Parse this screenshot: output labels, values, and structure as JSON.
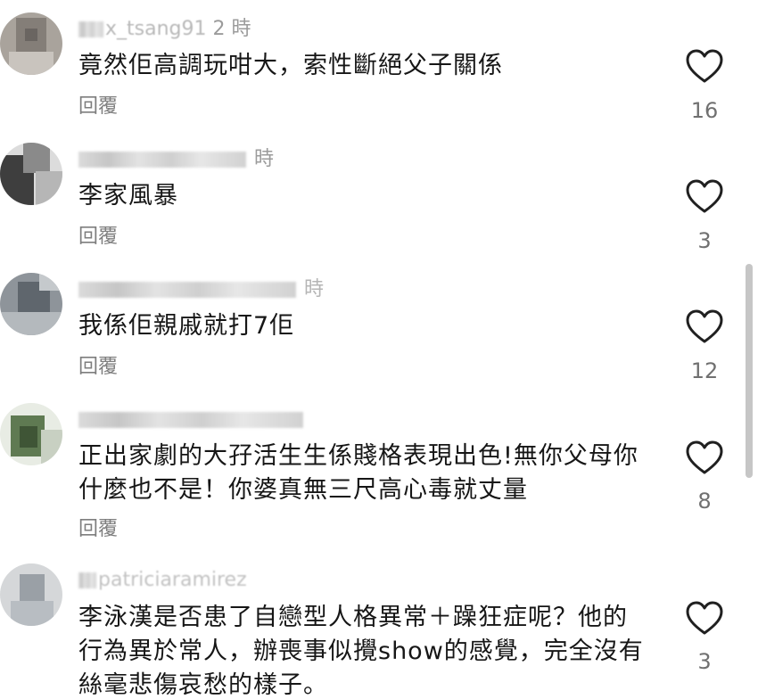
{
  "comments": [
    {
      "username_visible": "x_tsang91",
      "time_suffix": "2 時",
      "text": "竟然佢高調玩咁大，索性斷絕父子關係",
      "reply_label": "回覆",
      "likes": "16"
    },
    {
      "username_visible": "",
      "time_suffix": "時",
      "text": "李家風暴",
      "reply_label": "回覆",
      "likes": "3"
    },
    {
      "username_visible": "",
      "time_suffix": "時",
      "text": "我係佢親戚就打7佢",
      "reply_label": "回覆",
      "likes": "12"
    },
    {
      "username_visible": "",
      "time_suffix": "",
      "text": "正出家劇的大孖活生生係賤格表現出色!無你父母你什麼也不是！你婆真無三尺高心毒就丈量",
      "reply_label": "回覆",
      "likes": "8"
    },
    {
      "username_visible": "patriciaramirez",
      "time_suffix": "",
      "text": "李泳漢是否患了自戀型人格異常＋躁狂症呢？他的行為異於常人，辦喪事似攪show的感覺，完全沒有絲毫悲傷哀愁的樣子。",
      "reply_label": "",
      "likes": "3"
    }
  ]
}
